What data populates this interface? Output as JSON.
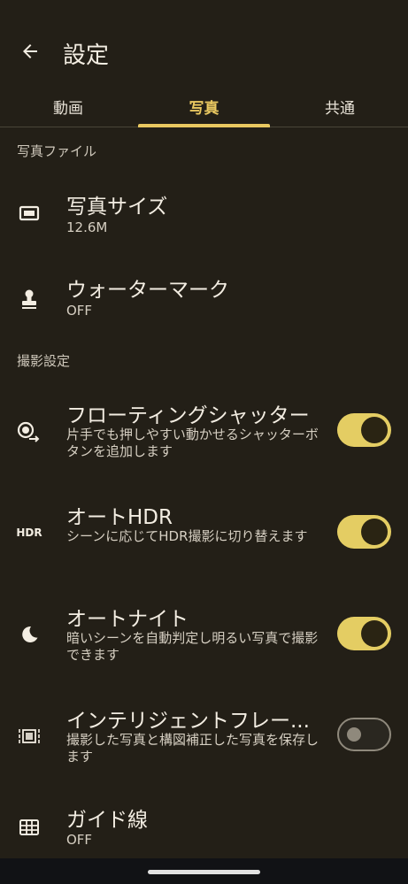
{
  "header": {
    "title": "設定",
    "back_icon": "arrow-back-icon"
  },
  "tabs": [
    {
      "label": "動画",
      "active": false
    },
    {
      "label": "写真",
      "active": true
    },
    {
      "label": "共通",
      "active": false
    }
  ],
  "sections": {
    "photo_file": "写真ファイル",
    "shooting_settings": "撮影設定"
  },
  "settings": {
    "photo_size": {
      "title": "写真サイズ",
      "value": "12.6M",
      "icon": "photo-size-icon"
    },
    "watermark": {
      "title": "ウォーターマーク",
      "value": "OFF",
      "icon": "stamp-icon"
    },
    "floating_shutter": {
      "title": "フローティングシャッター",
      "description": "片手でも押しやすい動かせるシャッターボタンを追加します",
      "enabled": true,
      "icon": "floating-shutter-icon"
    },
    "auto_hdr": {
      "title": "オートHDR",
      "description": "シーンに応じてHDR撮影に切り替えます",
      "enabled": true,
      "icon_text": "HDR"
    },
    "auto_night": {
      "title": "オートナイト",
      "description": "暗いシーンを自動判定し明るい写真で撮影できます",
      "enabled": true,
      "icon": "moon-icon"
    },
    "intelligent_frame": {
      "title": "インテリジェントフレー...",
      "description": "撮影した写真と構図補正した写真を保存します",
      "enabled": false,
      "icon": "frame-correction-icon"
    },
    "guide_lines": {
      "title": "ガイド線",
      "value": "OFF",
      "icon": "grid-icon"
    }
  },
  "colors": {
    "background": "#231f17",
    "accent": "#e9c860",
    "toggle_on": "#e4cd63"
  }
}
